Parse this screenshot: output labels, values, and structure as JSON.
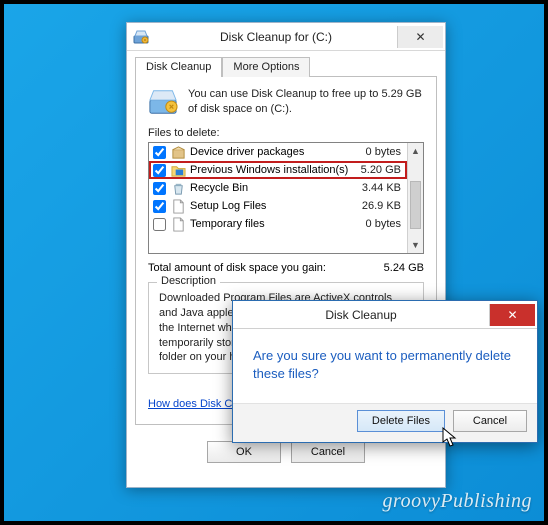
{
  "main": {
    "title": "Disk Cleanup for  (C:)",
    "tabs": [
      {
        "label": "Disk Cleanup"
      },
      {
        "label": "More Options"
      }
    ],
    "intro": "You can use Disk Cleanup to free up to 5.29 GB of disk space on  (C:).",
    "files_label": "Files to delete:",
    "files": [
      {
        "name": "Device driver packages",
        "size": "0 bytes",
        "checked": true,
        "highlight": false,
        "icon": "package"
      },
      {
        "name": "Previous Windows installation(s)",
        "size": "5.20 GB",
        "checked": true,
        "highlight": true,
        "icon": "winfolder"
      },
      {
        "name": "Recycle Bin",
        "size": "3.44 KB",
        "checked": true,
        "highlight": false,
        "icon": "recycle"
      },
      {
        "name": "Setup Log Files",
        "size": "26.9 KB",
        "checked": true,
        "highlight": false,
        "icon": "file"
      },
      {
        "name": "Temporary files",
        "size": "0 bytes",
        "checked": false,
        "highlight": false,
        "icon": "file"
      }
    ],
    "total_label": "Total amount of disk space you gain:",
    "total_value": "5.24 GB",
    "desc_legend": "Description",
    "desc": "Downloaded Program Files are ActiveX controls and Java applets downloaded automatically from the Internet when you view certain pages. They are temporarily stored in the Downloaded Program Files folder on your hard disk.",
    "link": "How does Disk Cleanup work?",
    "ok": "OK",
    "cancel": "Cancel"
  },
  "confirm": {
    "title": "Disk Cleanup",
    "message": "Are you sure you want to permanently delete these files?",
    "delete": "Delete Files",
    "cancel": "Cancel"
  },
  "brand": "groovyPublishing"
}
